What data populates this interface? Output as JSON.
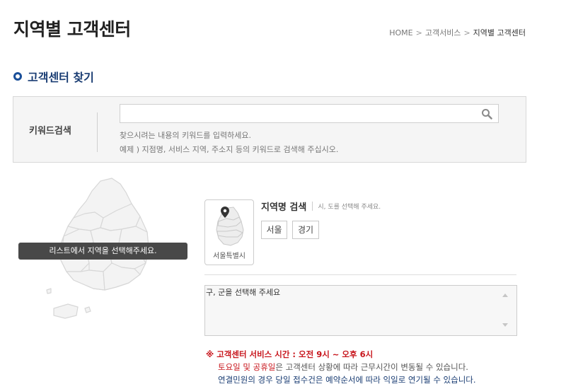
{
  "page": {
    "title": "지역별 고객센터"
  },
  "breadcrumb": {
    "items": [
      "HOME",
      "고객서비스",
      "지역별 고객센터"
    ],
    "separator": ">"
  },
  "section": {
    "title": "고객센터 찾기"
  },
  "keyword_search": {
    "label": "키워드검색",
    "value": "",
    "help_line1": "찾으시려는 내용의 키워드를 입력하세요.",
    "help_line2": "예제 ) 지점명, 서비스 지역, 주소지 등의 키워드로 검색해 주십시오.",
    "icon": "search-icon"
  },
  "map": {
    "tooltip": "리스트에서 지역을 선택해주세요.",
    "icon": "korea-map-icon"
  },
  "region": {
    "thumb_label": "서울특별시",
    "thumb_icon": "location-pin-icon",
    "search_title": "지역명 검색",
    "search_hint": "시, 도를 선택해 주세요.",
    "cities": [
      "서울",
      "경기"
    ]
  },
  "district": {
    "placeholder": "구, 군을 선택해 주세요"
  },
  "notice": {
    "mark": "※",
    "hours": "고객센터 서비스 시간 : 오전 9시 ~ 오후 6시",
    "holiday_highlight": "토요일 및 공휴일",
    "holiday_rest": "은 고객센터 상황에 따라 근무시간이 변동될 수 있습니다.",
    "complaint": "연결민원의 경우 당일 접수건은 예약순서에 따라 익일로 연기될 수 있습니다."
  },
  "colors": {
    "accent": "#1a3d73",
    "warning": "#c8161d",
    "tooltip_bg": "#484848"
  }
}
